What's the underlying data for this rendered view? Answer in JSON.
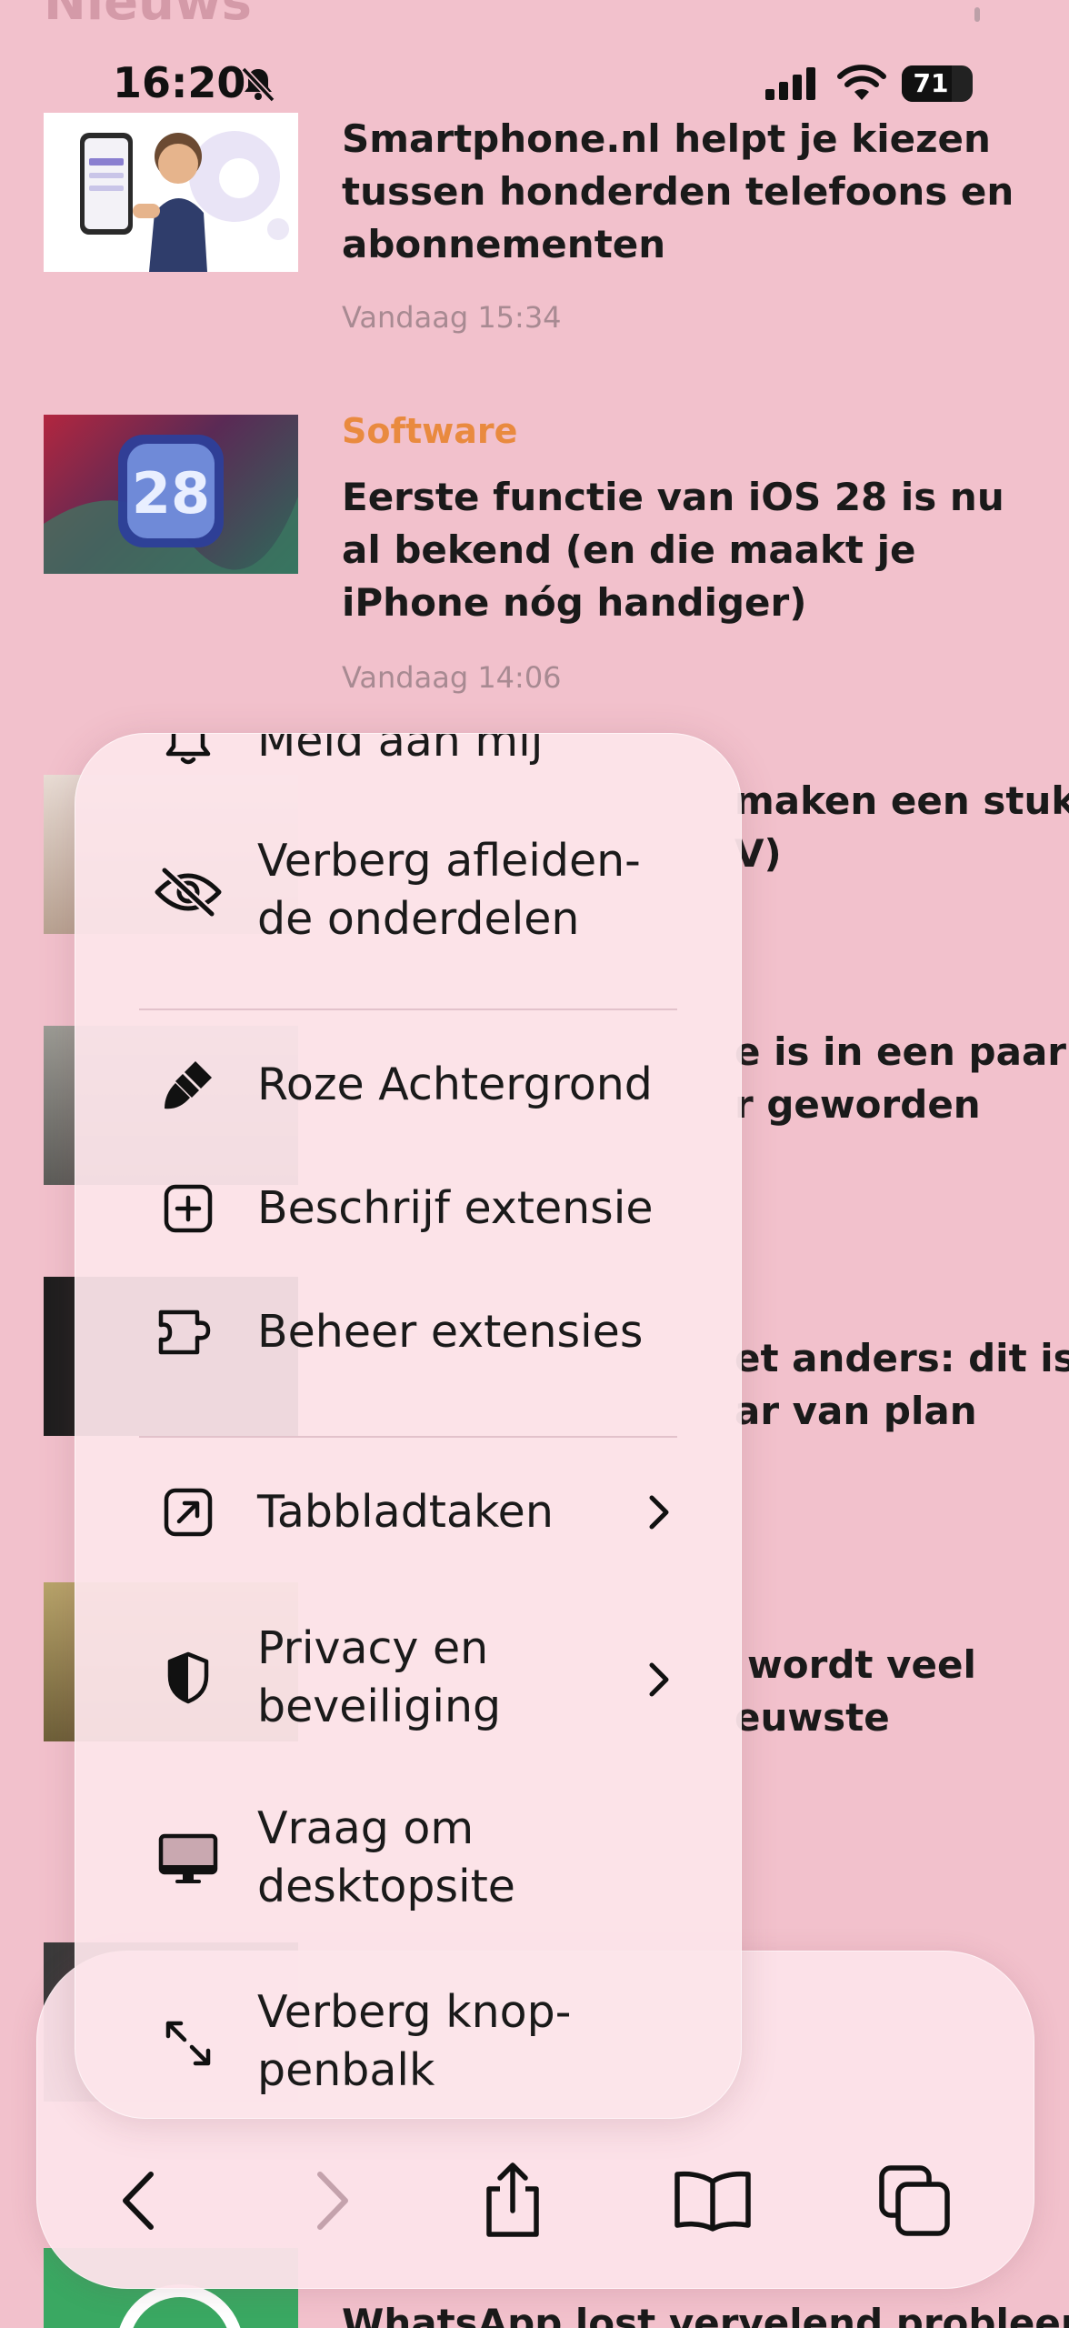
{
  "page": {
    "section_title": "Nieuws"
  },
  "status_bar": {
    "time": "16:20",
    "battery": "71",
    "battery_level": 0.71
  },
  "articles": [
    {
      "category": "",
      "title": "Smartphone.nl helpt je kiezen tussen honderden telefoons en abonnementen",
      "date": "Vandaag 15:34"
    },
    {
      "category": "Software",
      "title": "Eerste functie van iOS 28 is nu al bekend (en die maakt je iPhone nóg handiger)",
      "date": "Vandaag 14:06"
    }
  ],
  "partial_titles": [
    {
      "line1": "maken een stuk",
      "line2": "V)"
    },
    {
      "line1": "e is in een paar",
      "line2": "r geworden"
    },
    {
      "line1": "et anders: dit is",
      "line2": "ar van plan"
    },
    {
      "line1": "wordt veel",
      "line2": "euwste"
    },
    {
      "line1": "WhatsApp lost vervelend probleem",
      "line2": ""
    }
  ],
  "menu": {
    "items": [
      {
        "label": "Meld aan mij",
        "icon": "bell-icon"
      },
      {
        "label": "Verberg afleiden-de onderdelen",
        "icon": "eye-slash-icon"
      },
      {
        "label": "Roze Achtergrond",
        "icon": "brush-icon"
      },
      {
        "label": "Beschrijf extensie",
        "icon": "plus-square-icon"
      },
      {
        "label": "Beheer extensies",
        "icon": "puzzle-icon"
      },
      {
        "label": "Tabbladtaken",
        "icon": "arrow-up-right-square-icon"
      },
      {
        "label": "Privacy en beveiliging",
        "icon": "shield-icon"
      },
      {
        "label": "Vraag om desktopsite",
        "icon": "desktop-icon"
      },
      {
        "label": "Verberg knop-penbalk",
        "icon": "expand-arrows-icon"
      }
    ]
  },
  "toolbar": {
    "buttons": [
      "back-icon",
      "forward-icon",
      "share-icon",
      "bookmarks-icon",
      "tabs-icon"
    ]
  },
  "colors": {
    "background": "#f2c1cc",
    "category": "#e98a3f",
    "date": "#a88a92",
    "menu": "#fce4ea"
  }
}
